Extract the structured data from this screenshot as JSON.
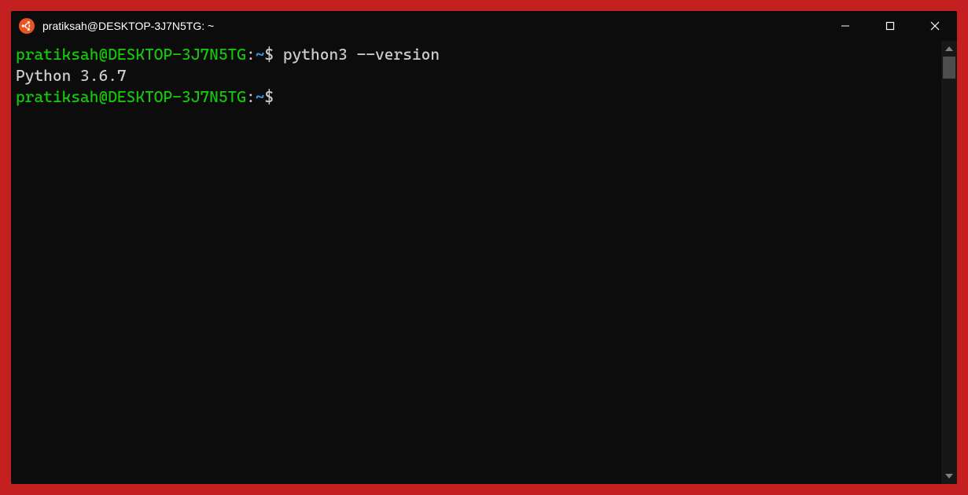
{
  "titlebar": {
    "title": "pratiksah@DESKTOP-3J7N5TG: ~"
  },
  "terminal": {
    "lines": [
      {
        "user": "pratiksah@DESKTOP-3J7N5TG",
        "colon": ":",
        "path": "~",
        "dollar": "$",
        "command": " python3 --version"
      },
      {
        "output": "Python 3.6.7"
      },
      {
        "user": "pratiksah@DESKTOP-3J7N5TG",
        "colon": ":",
        "path": "~",
        "dollar": "$",
        "command": ""
      }
    ]
  }
}
